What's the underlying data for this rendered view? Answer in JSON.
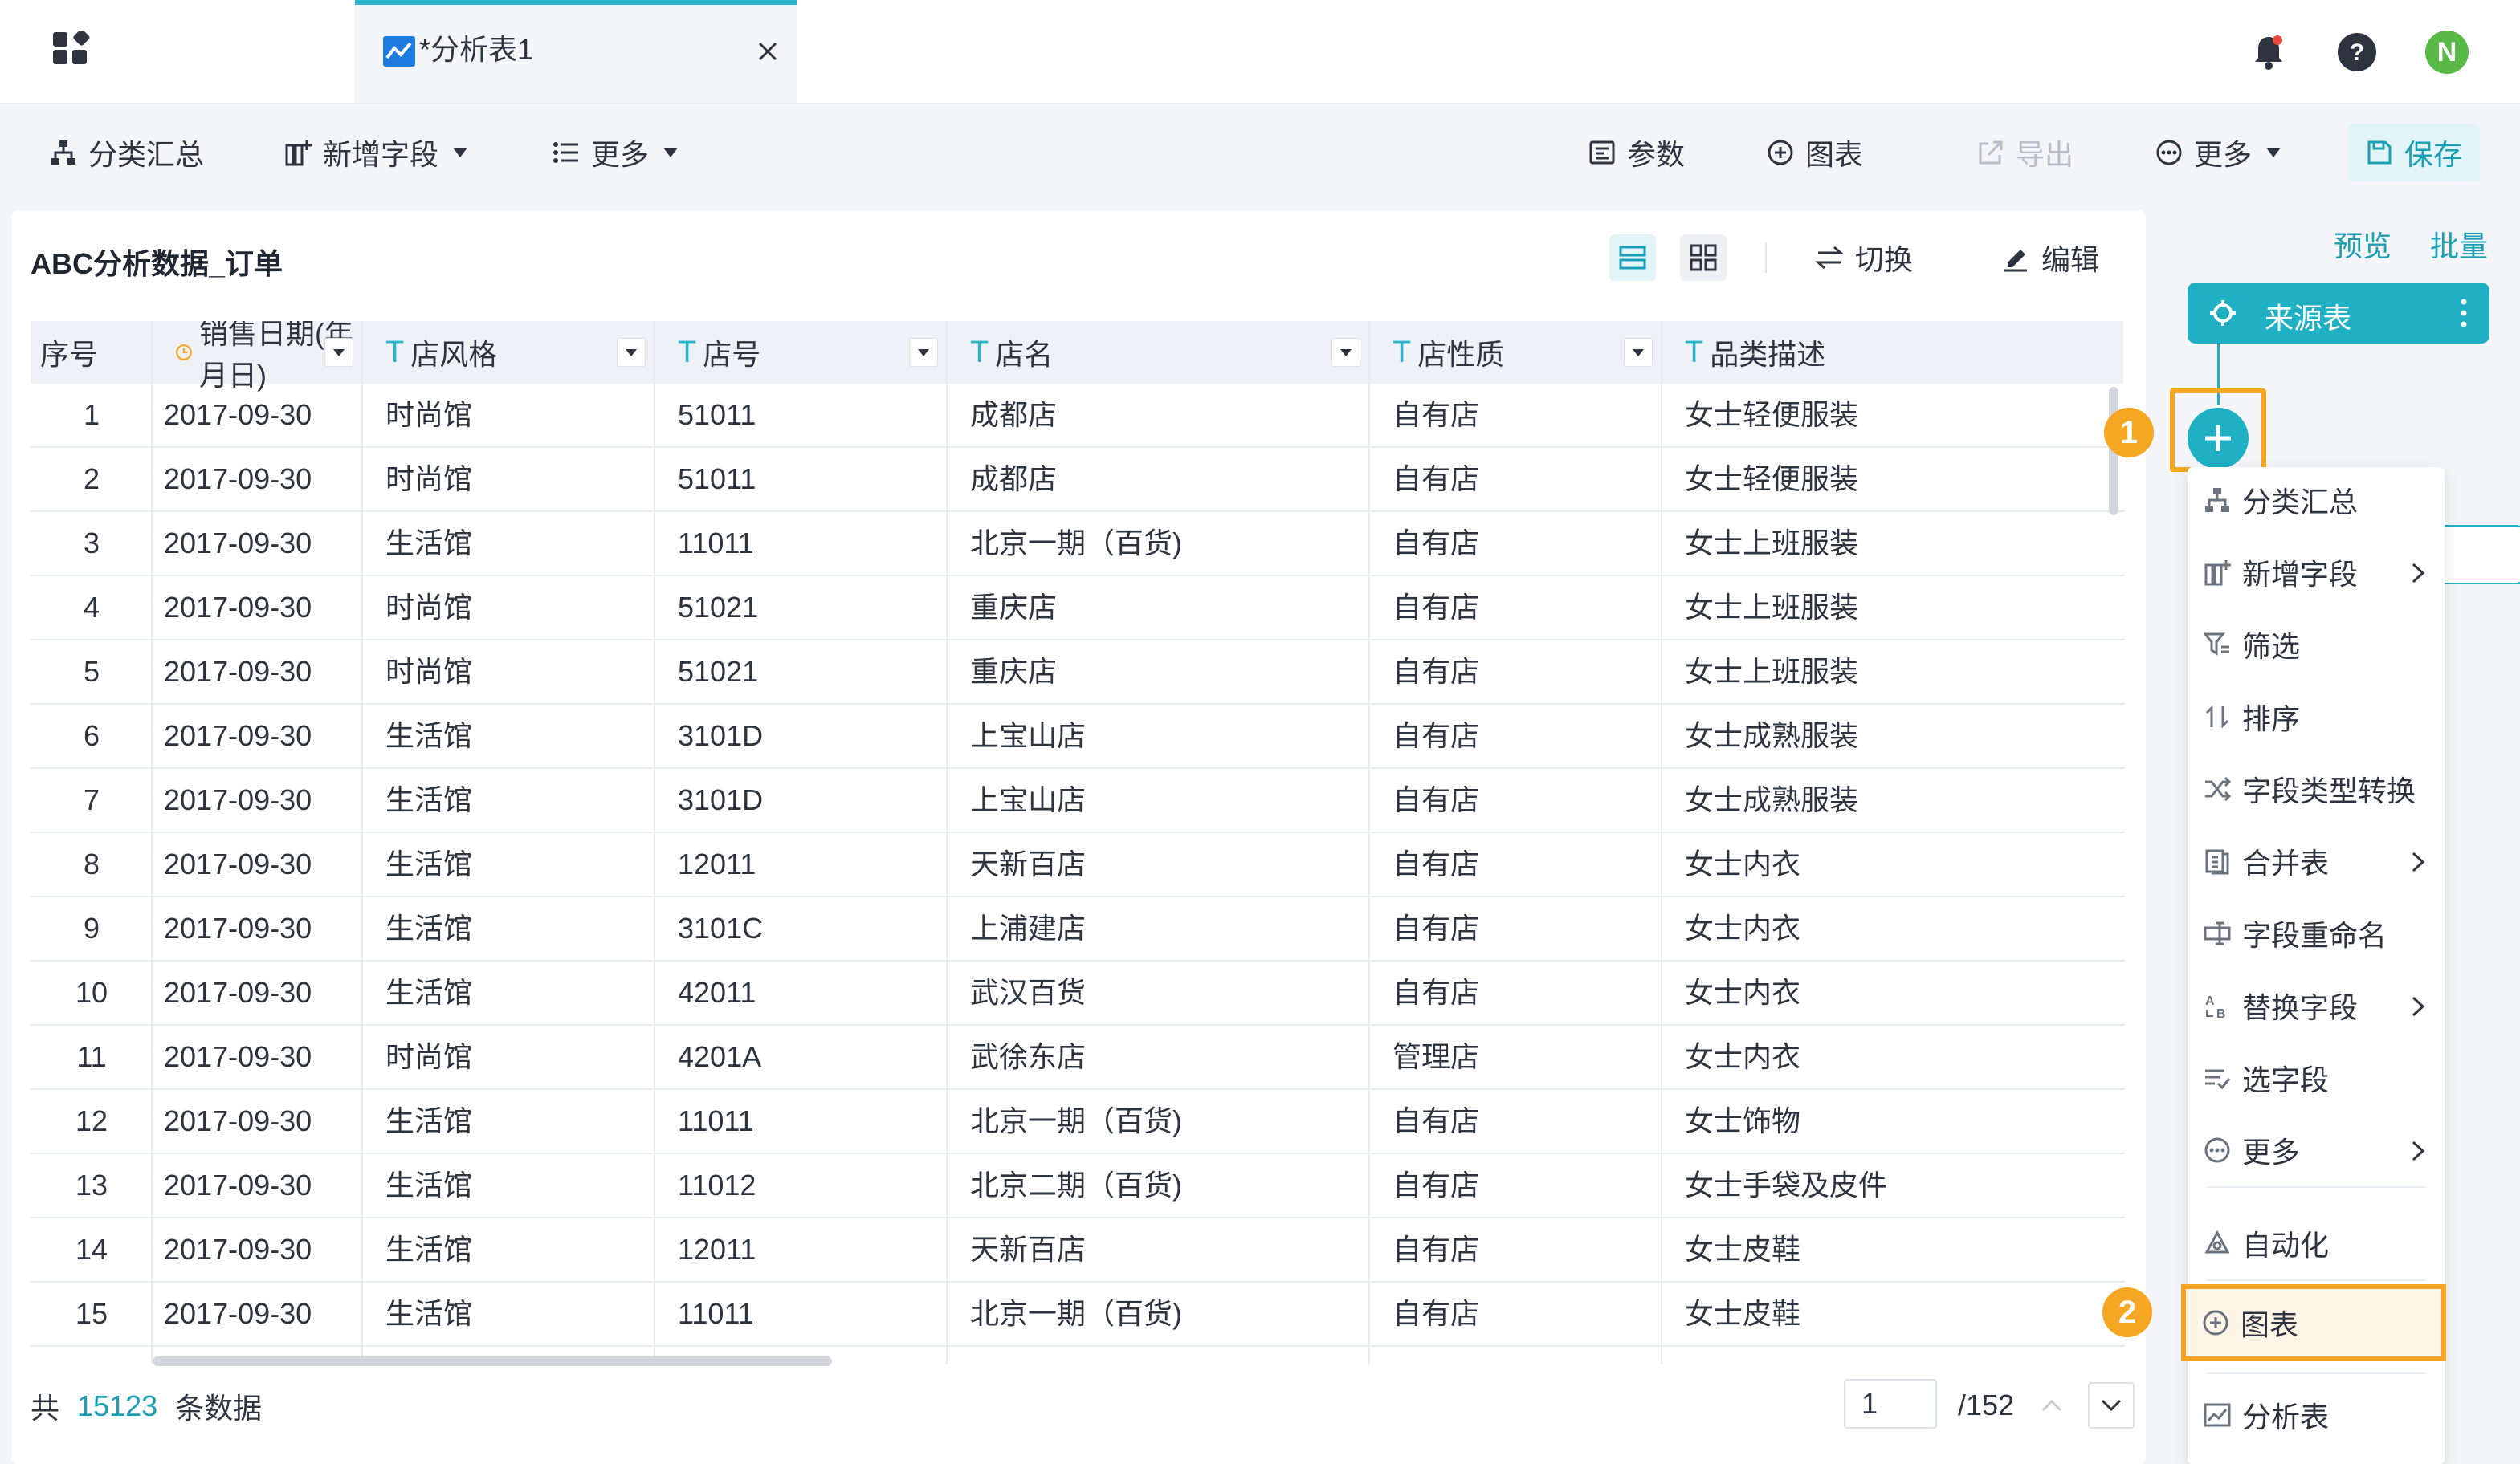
{
  "tab": {
    "title": "*分析表1"
  },
  "header": {
    "avatar_letter": "N"
  },
  "toolbar": {
    "group_summary": "分类汇总",
    "add_field": "新增字段",
    "more_left": "更多",
    "params": "参数",
    "chart": "图表",
    "export": "导出",
    "more_right": "更多",
    "save": "保存"
  },
  "main": {
    "dataset_title": "ABC分析数据_订单",
    "switch_label": "切换",
    "edit_label": "编辑"
  },
  "table": {
    "columns": [
      "序号",
      "销售日期(年月日)",
      "店风格",
      "店号",
      "店名",
      "店性质",
      "品类描述"
    ],
    "rows": [
      [
        "1",
        "2017-09-30",
        "时尚馆",
        "51011",
        "成都店",
        "自有店",
        "女士轻便服装"
      ],
      [
        "2",
        "2017-09-30",
        "时尚馆",
        "51011",
        "成都店",
        "自有店",
        "女士轻便服装"
      ],
      [
        "3",
        "2017-09-30",
        "生活馆",
        "11011",
        "北京一期（百货)",
        "自有店",
        "女士上班服装"
      ],
      [
        "4",
        "2017-09-30",
        "时尚馆",
        "51021",
        "重庆店",
        "自有店",
        "女士上班服装"
      ],
      [
        "5",
        "2017-09-30",
        "时尚馆",
        "51021",
        "重庆店",
        "自有店",
        "女士上班服装"
      ],
      [
        "6",
        "2017-09-30",
        "生活馆",
        "3101D",
        "上宝山店",
        "自有店",
        "女士成熟服装"
      ],
      [
        "7",
        "2017-09-30",
        "生活馆",
        "3101D",
        "上宝山店",
        "自有店",
        "女士成熟服装"
      ],
      [
        "8",
        "2017-09-30",
        "生活馆",
        "12011",
        "天新百店",
        "自有店",
        "女士内衣"
      ],
      [
        "9",
        "2017-09-30",
        "生活馆",
        "3101C",
        "上浦建店",
        "自有店",
        "女士内衣"
      ],
      [
        "10",
        "2017-09-30",
        "生活馆",
        "42011",
        "武汉百货",
        "自有店",
        "女士内衣"
      ],
      [
        "11",
        "2017-09-30",
        "时尚馆",
        "4201A",
        "武徐东店",
        "管理店",
        "女士内衣"
      ],
      [
        "12",
        "2017-09-30",
        "生活馆",
        "11011",
        "北京一期（百货)",
        "自有店",
        "女士饰物"
      ],
      [
        "13",
        "2017-09-30",
        "生活馆",
        "11012",
        "北京二期（百货)",
        "自有店",
        "女士手袋及皮件"
      ],
      [
        "14",
        "2017-09-30",
        "生活馆",
        "12011",
        "天新百店",
        "自有店",
        "女士皮鞋"
      ],
      [
        "15",
        "2017-09-30",
        "生活馆",
        "11011",
        "北京一期（百货)",
        "自有店",
        "女士皮鞋"
      ]
    ]
  },
  "footer": {
    "prefix": "共",
    "total": "15123",
    "suffix": "条数据",
    "page_value": "1",
    "page_total": "/152"
  },
  "flow": {
    "preview": "预览",
    "batch": "批量",
    "source_node": "来源表",
    "badge1": "1",
    "badge2": "2"
  },
  "menu": {
    "items": [
      "分类汇总",
      "新增字段",
      "筛选",
      "排序",
      "字段类型转换",
      "合并表",
      "字段重命名",
      "替换字段",
      "选字段",
      "更多",
      "自动化",
      "图表",
      "分析表"
    ]
  },
  "colors": {
    "accent": "#20b0c4",
    "highlight": "#f5a623"
  }
}
